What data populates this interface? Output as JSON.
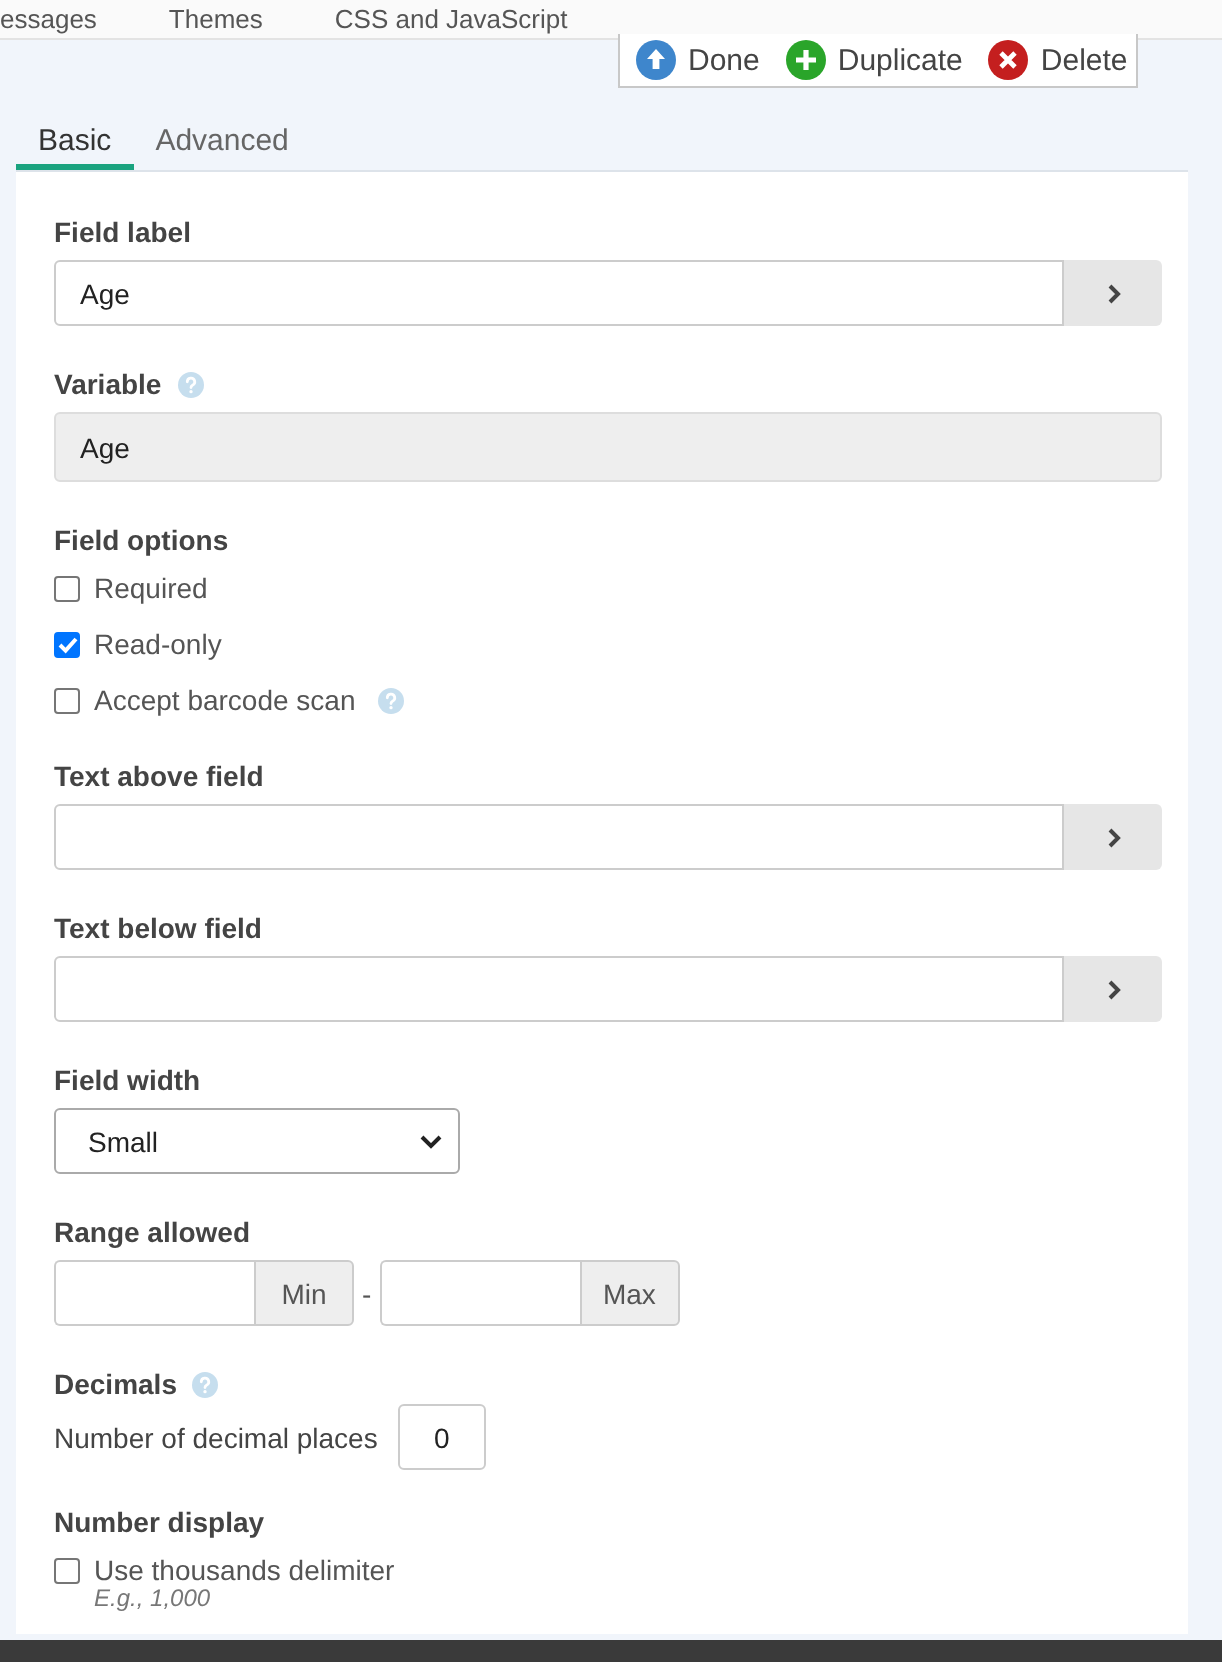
{
  "top_tabs": [
    {
      "label": "essages"
    },
    {
      "label": "Themes"
    },
    {
      "label": "CSS and JavaScript"
    }
  ],
  "actions": [
    {
      "kind": "done",
      "label": "Done"
    },
    {
      "kind": "duplicate",
      "label": "Duplicate"
    },
    {
      "kind": "delete",
      "label": "Delete"
    }
  ],
  "tabs": [
    {
      "label": "Basic",
      "selected": true
    },
    {
      "label": "Advanced",
      "selected": false
    }
  ],
  "fields": [
    {
      "kind": "text-expand",
      "label": "Field label",
      "value": "Age"
    },
    {
      "kind": "readonly",
      "label": "Variable",
      "help": true,
      "value": "Age"
    },
    {
      "kind": "checks",
      "label": "Field options",
      "options": [
        {
          "label": "Required",
          "checked": false
        },
        {
          "label": "Read-only",
          "checked": true
        },
        {
          "label": "Accept barcode scan",
          "checked": false,
          "help": true
        }
      ]
    },
    {
      "kind": "text-expand",
      "label": "Text above field"
    },
    {
      "kind": "text-expand",
      "label": "Text below field"
    },
    {
      "kind": "select",
      "label": "Field width",
      "value": "Small"
    },
    {
      "kind": "range",
      "label": "Range allowed",
      "min_addon": "Min",
      "separator": "-",
      "max_addon": "Max"
    },
    {
      "kind": "number",
      "label": "Decimals",
      "help": true,
      "prompt": "Number of decimal places",
      "value": "0"
    },
    {
      "kind": "checks",
      "label": "Number display",
      "options": [
        {
          "label": "Use thousands delimiter",
          "checked": false,
          "hint": "E.g., 1,000"
        }
      ]
    }
  ]
}
